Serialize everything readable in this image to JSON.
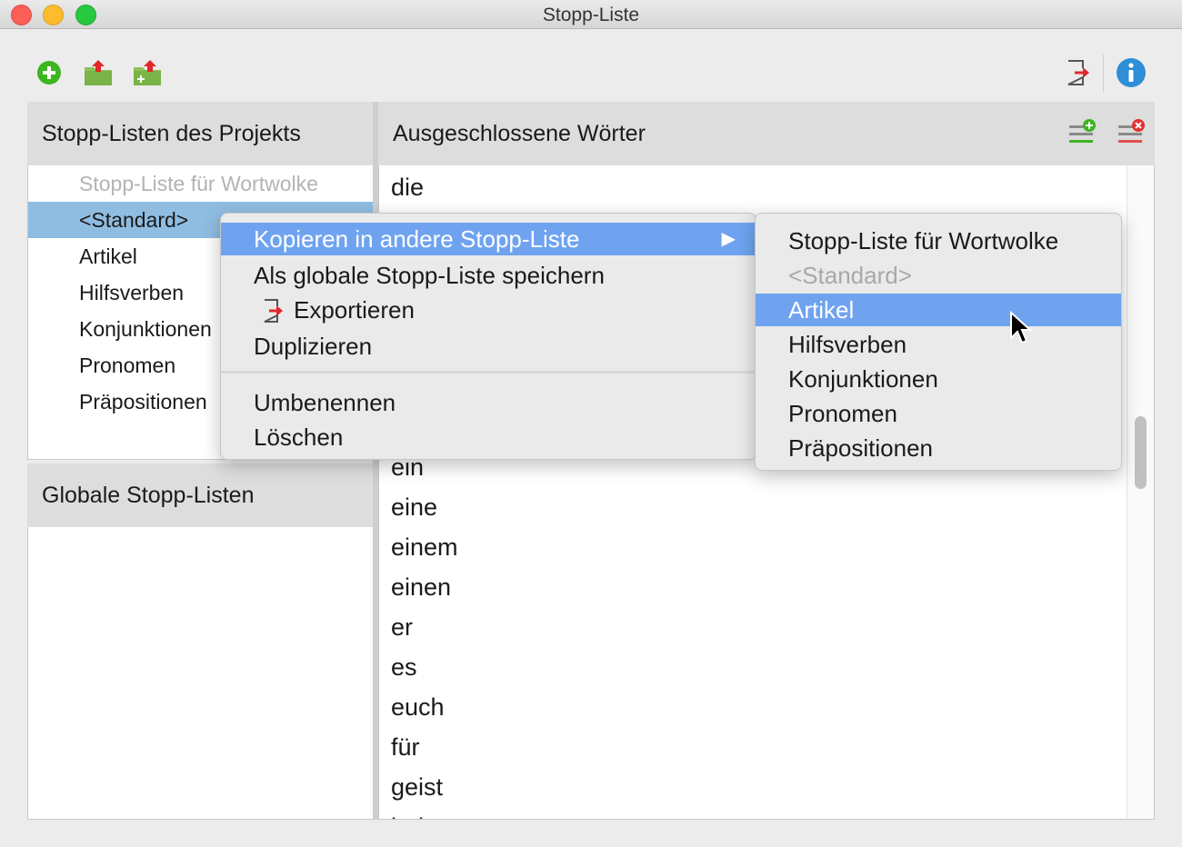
{
  "window": {
    "title": "Stopp-Liste"
  },
  "toolbar": {
    "icons": [
      "add-icon",
      "import-icon",
      "import-new-icon",
      "export-icon",
      "info-icon"
    ],
    "colors": {
      "add": "#3cb521",
      "folder": "#8dc25a",
      "arrow": "#e0282a",
      "info": "#2f8fd6"
    }
  },
  "left": {
    "project_header": "Stopp-Listen des Projekts",
    "project_lists": [
      {
        "label": "Stopp-Liste für Wortwolke",
        "state": "disabled"
      },
      {
        "label": "<Standard>",
        "state": "selected"
      },
      {
        "label": "Artikel",
        "state": "normal"
      },
      {
        "label": "Hilfsverben",
        "state": "normal"
      },
      {
        "label": "Konjunktionen",
        "state": "normal"
      },
      {
        "label": "Pronomen",
        "state": "normal"
      },
      {
        "label": "Präpositionen",
        "state": "normal"
      }
    ],
    "global_header": "Globale Stopp-Listen"
  },
  "right": {
    "header": "Ausgeschlossene Wörter",
    "words_top": [
      "die"
    ],
    "words": [
      "ein",
      "eine",
      "einem",
      "einen",
      "er",
      "es",
      "euch",
      "für",
      "geist",
      "habe"
    ]
  },
  "context_menu": {
    "items": [
      {
        "label": "Kopieren in andere Stopp-Liste",
        "highlighted": true,
        "submenu": true
      },
      {
        "label": "Als globale Stopp-Liste speichern"
      },
      {
        "label": "Exportieren",
        "icon": "export-icon"
      },
      {
        "label": "Duplizieren"
      }
    ],
    "items2": [
      {
        "label": "Umbenennen"
      },
      {
        "label": "Löschen"
      }
    ],
    "submenu_arrow": "▶"
  },
  "submenu": {
    "items": [
      {
        "label": "Stopp-Liste für Wortwolke",
        "state": "normal"
      },
      {
        "label": "<Standard>",
        "state": "disabled"
      },
      {
        "label": "Artikel",
        "state": "highlighted"
      },
      {
        "label": "Hilfsverben",
        "state": "normal"
      },
      {
        "label": "Konjunktionen",
        "state": "normal"
      },
      {
        "label": "Pronomen",
        "state": "normal"
      },
      {
        "label": "Präpositionen",
        "state": "normal"
      }
    ]
  },
  "colors": {
    "selection": "#8fbde2",
    "menu_highlight": "#6fa3f0"
  }
}
